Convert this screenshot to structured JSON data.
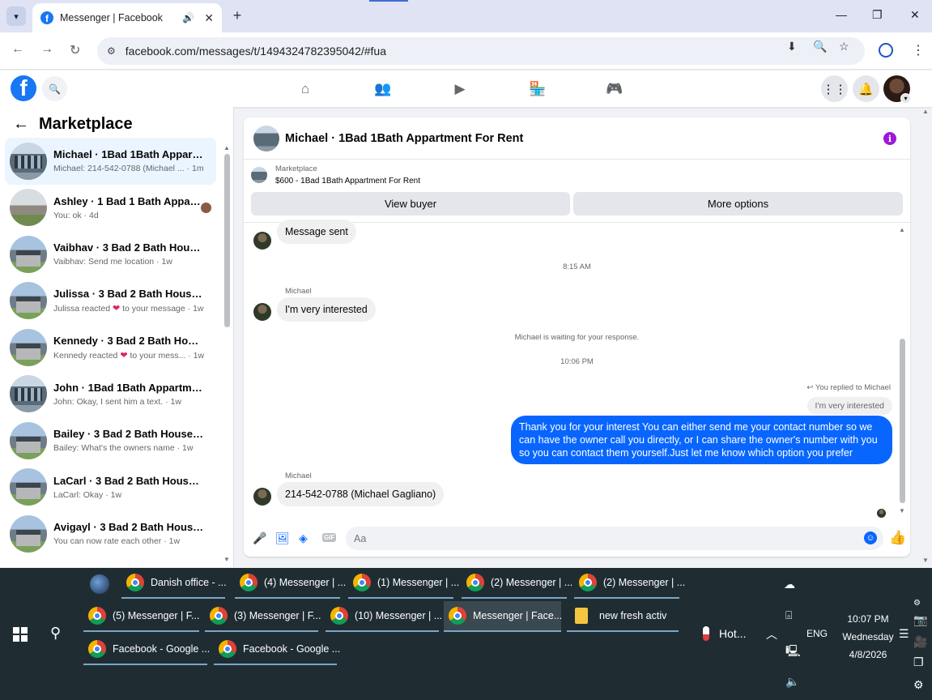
{
  "browser": {
    "tab_title": "Messenger | Facebook",
    "url": "facebook.com/messages/t/1494324782395042/#fua"
  },
  "sidebar": {
    "title": "Marketplace",
    "conversations": [
      {
        "name": "Michael · 1Bad 1Bath Appartme...",
        "snippet": "Michael: 214-542-0788 (Michael ... · 1m",
        "thumb": "apt"
      },
      {
        "name": "Ashley · 1 Bad 1 Bath Appart...",
        "snippet": "You: ok · 4d",
        "thumb": "plain"
      },
      {
        "name": "Vaibhav · 3 Bad 2 Bath House F...",
        "snippet": "Vaibhav: Send me location · 1w",
        "thumb": "house"
      },
      {
        "name": "Julissa · 3 Bad 2 Bath House For...",
        "snippet_pre": "Julissa reacted",
        "snippet_post": "to your message · 1w",
        "thumb": "house"
      },
      {
        "name": "Kennedy · 3 Bad 2 Bath House F...",
        "snippet_pre": "Kennedy reacted",
        "snippet_post": "to your mess... · 1w",
        "thumb": "house"
      },
      {
        "name": "John · 1Bad 1Bath Appartment F...",
        "snippet": "John: Okay, I sent him a text. · 1w",
        "thumb": "apt"
      },
      {
        "name": "Bailey · 3 Bad 2 Bath House For ...",
        "snippet": "Bailey: What's the owners name · 1w",
        "thumb": "house"
      },
      {
        "name": "LaCarl · 3 Bad 2 Bath House For...",
        "snippet": "LaCarl: Okay · 1w",
        "thumb": "house"
      },
      {
        "name": "Avigayl · 3 Bad 2 Bath House Fo...",
        "snippet": "You can now rate each other · 1w",
        "thumb": "house"
      }
    ]
  },
  "chat": {
    "title": "Michael · 1Bad 1Bath Appartment For Rent",
    "marketplace_label": "Marketplace",
    "listing": "$600 - 1Bad 1Bath Appartment For Rent",
    "view_buyer": "View buyer",
    "more_options": "More options",
    "messages": {
      "msg1": "Message sent",
      "time1": "8:15 AM",
      "sender1": "Michael",
      "msg2": "I'm very interested",
      "waiting": "Michael is waiting for your response.",
      "time2": "10:06 PM",
      "replied_label": "You replied to Michael",
      "quoted": "I'm very interested",
      "reply": "Thank you for your interest You can either send me your contact number so we can have the owner call you directly, or I can share the owner's number with you so you can contact them yourself.Just let me know which option you prefer",
      "sender2": "Michael",
      "msg3": "214-542-0788 (Michael Gagliano)"
    },
    "input_placeholder": "Aa"
  },
  "taskbar": {
    "row1": [
      "Danish office - ...",
      "(4) Messenger | ...",
      "(1) Messenger | ...",
      "(2) Messenger | ...",
      "(2) Messenger | ..."
    ],
    "row2": [
      "(5) Messenger | F...",
      "(3) Messenger | F...",
      "(10) Messenger | ...",
      "Messenger | Face...",
      "new fresh activ"
    ],
    "row3": [
      "Facebook - Google ...",
      "Facebook - Google ..."
    ],
    "weather": "Hot...",
    "language": "ENG",
    "time": "10:07 PM",
    "day": "Wednesday",
    "date": "4/8/2026"
  },
  "colors": {
    "accent": "#0866ff",
    "fb_blue": "#1877f2",
    "info_purple": "#9d18d9"
  }
}
